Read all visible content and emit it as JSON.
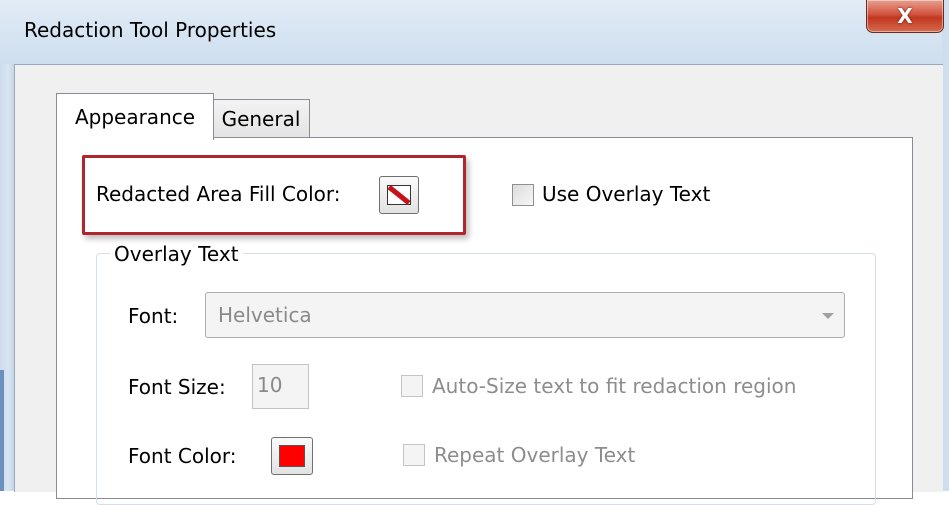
{
  "window": {
    "title": "Redaction Tool Properties",
    "close_glyph": "X"
  },
  "tabs": [
    {
      "label": "Appearance",
      "selected": true
    },
    {
      "label": "General",
      "selected": false
    }
  ],
  "appearance": {
    "fill_color_label": "Redacted Area Fill Color:",
    "fill_color_value": "no-color",
    "use_overlay": {
      "label": "Use Overlay Text",
      "checked": false
    },
    "overlay_group": {
      "title": "Overlay Text",
      "font_label": "Font:",
      "font_value": "Helvetica",
      "font_size_label": "Font Size:",
      "font_size_value": "10",
      "autosize": {
        "label": "Auto-Size text to fit redaction region",
        "checked": false,
        "enabled": false
      },
      "font_color_label": "Font Color:",
      "font_color": "#ff0000",
      "repeat": {
        "label": "Repeat Overlay Text",
        "checked": false,
        "enabled": false
      }
    }
  },
  "colors": {
    "highlight": "#b0262d",
    "no_color_slash": "#c4141b"
  }
}
